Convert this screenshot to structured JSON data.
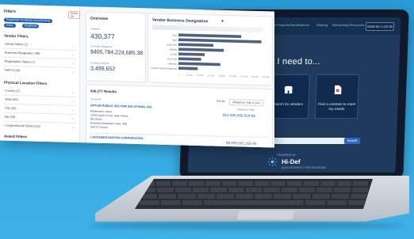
{
  "site": {
    "nav": [
      "Environment-Native Features",
      "Specifications",
      "Sharing",
      "Networking Resources"
    ],
    "login_label": "SIGN IN / LOG IN",
    "headline": "I need to...",
    "tiles": [
      {
        "label": "Search for vendors",
        "icon": "storefront-icon"
      },
      {
        "label": "Find a contract to meet my needs",
        "icon": "document-icon"
      }
    ],
    "search_go": "Search",
    "powered_by": "POWERED BY",
    "brand": "Hi-Def",
    "brand_sub": "DATA INTEGRITY FOR DECISIONS"
  },
  "filters": {
    "title": "Filters",
    "reset_label": "Reset All",
    "chips": [
      "Registration Number(s): Active/Existing",
      "Active",
      "Registered"
    ],
    "vendor_section": "Vendor Filters",
    "vendor_rows": [
      {
        "label": "Vendor Name",
        "count": "(1)"
      },
      {
        "label": "Business Designation",
        "count": "(48)"
      },
      {
        "label": "Registration Status",
        "count": "(1)"
      },
      {
        "label": "NAICS",
        "count": "(10)"
      }
    ],
    "location_section": "Physical Location Filters",
    "location_rows": [
      {
        "label": "Country",
        "count": "(1)"
      },
      {
        "label": "State",
        "count": "(50)"
      },
      {
        "label": "City",
        "count": "(20)"
      },
      {
        "label": "Zip",
        "count": "(20)"
      },
      {
        "label": "Congressional District",
        "count": "(20)"
      }
    ],
    "award_section": "Award Filters"
  },
  "overview": {
    "title": "Overview",
    "stat1_label": "Vendors",
    "stat1_value": "430,377",
    "stat2_label": "Contract Obligation",
    "stat2_value": "$405,784,224,685.38",
    "stat3_label": "Contract Actions",
    "stat3_value": "3,499,652"
  },
  "chart_data": {
    "type": "bar",
    "title": "Vendor Business Designation",
    "categories": [
      "8(a)",
      "SDB",
      "HUBZone",
      "WOSB",
      "VOSB",
      "SDVOSB",
      "Minority",
      "Woman Owned Business"
    ],
    "values": [
      72,
      95,
      40,
      52,
      30,
      26,
      48,
      22
    ],
    "xticks": [
      "0",
      "20,000",
      "40,000",
      "60,000",
      "80,000",
      "100,000",
      "120,000",
      "140,000",
      "160,000"
    ],
    "xlim": [
      0,
      160000
    ]
  },
  "results": {
    "title": "430,377 Results",
    "sort_label": "Sort By:",
    "sort_value": "Obligations: High to Low",
    "col_vendor": "VENDOR",
    "col_obligation": "Obligation Total",
    "rows": [
      {
        "name": "OPTUM PUBLIC SECTOR SOLUTIONS, INC.",
        "lines": [
          "Registration: Active",
          "11000 Optum Circle, Eden Prairie",
          "MN 55344",
          "Business Designation: 8(a), SDB",
          "NAICS: 524114"
        ],
        "amount": "$10,495,098,524.88"
      },
      {
        "name": "LOCKHEED MARTIN CORPORATION",
        "lines": [],
        "amount": "$9,595,007,202.45"
      }
    ]
  }
}
